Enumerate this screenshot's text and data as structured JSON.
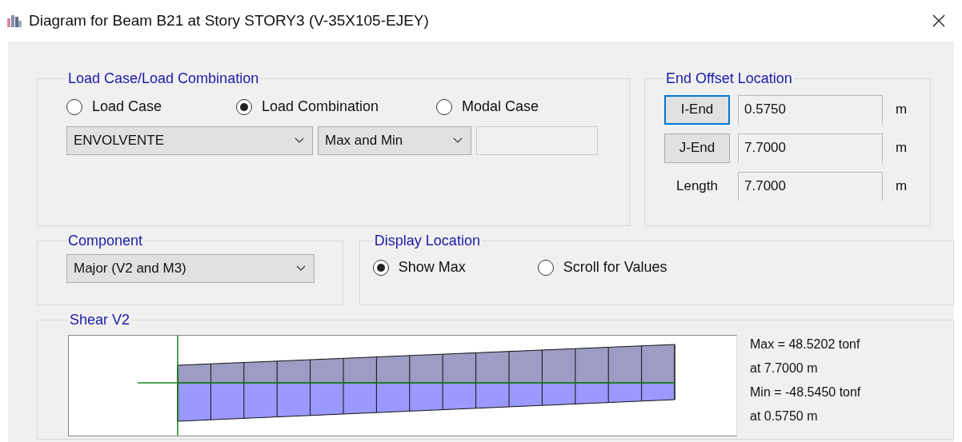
{
  "window": {
    "title": "Diagram for Beam B21 at Story STORY3 (V-35X105-EJEY)"
  },
  "load_case": {
    "title": "Load Case/Load Combination",
    "options": [
      {
        "label": "Load Case",
        "selected": false
      },
      {
        "label": "Load Combination",
        "selected": true
      },
      {
        "label": "Modal Case",
        "selected": false
      }
    ],
    "combination": "ENVOLVENTE",
    "mode": "Max and Min"
  },
  "end_offset": {
    "title": "End Offset Location",
    "rows": [
      {
        "kind": "button",
        "label": "I-End",
        "value": "0.5750",
        "unit": "m",
        "focused": true
      },
      {
        "kind": "button",
        "label": "J-End",
        "value": "7.7000",
        "unit": "m",
        "focused": false
      },
      {
        "kind": "label",
        "label": "Length",
        "value": "7.7000",
        "unit": "m"
      }
    ]
  },
  "component": {
    "title": "Component",
    "value": "Major (V2 and M3)"
  },
  "display_location": {
    "title": "Display Location",
    "options": [
      {
        "label": "Show Max",
        "selected": true
      },
      {
        "label": "Scroll for Values",
        "selected": false
      }
    ]
  },
  "shear": {
    "title": "Shear V2",
    "results": [
      "Max = 48.5202 tonf",
      "at 7.7000 m",
      "Min = -48.5450 tonf",
      "at 0.5750 m"
    ]
  }
}
